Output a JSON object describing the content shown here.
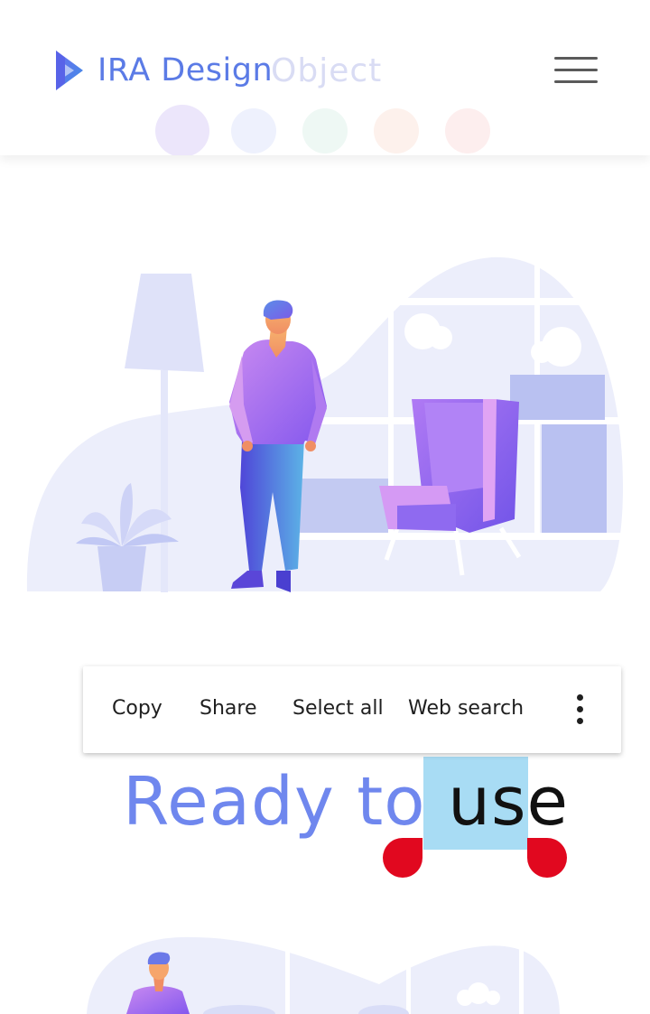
{
  "header": {
    "logo_text": "IRA Design",
    "ghost_title": "Object",
    "menu_icon": "hamburger-menu-icon"
  },
  "colors": {
    "brand_blue": "#5b7be6",
    "headline_blue": "#6f87ee",
    "selection_bg": "#a8dcf4",
    "selection_handle": "#e1081f",
    "illustration_light": "#e8eafb",
    "illustration_mid": "#b7c0f3",
    "illustration_purple": "#8b5cf6"
  },
  "context_menu": {
    "items": [
      "Copy",
      "Share",
      "Select all",
      "Web search"
    ],
    "more_icon": "more-vertical-icon"
  },
  "headline": {
    "prefix": "Ready to ",
    "selected_word": "use"
  }
}
